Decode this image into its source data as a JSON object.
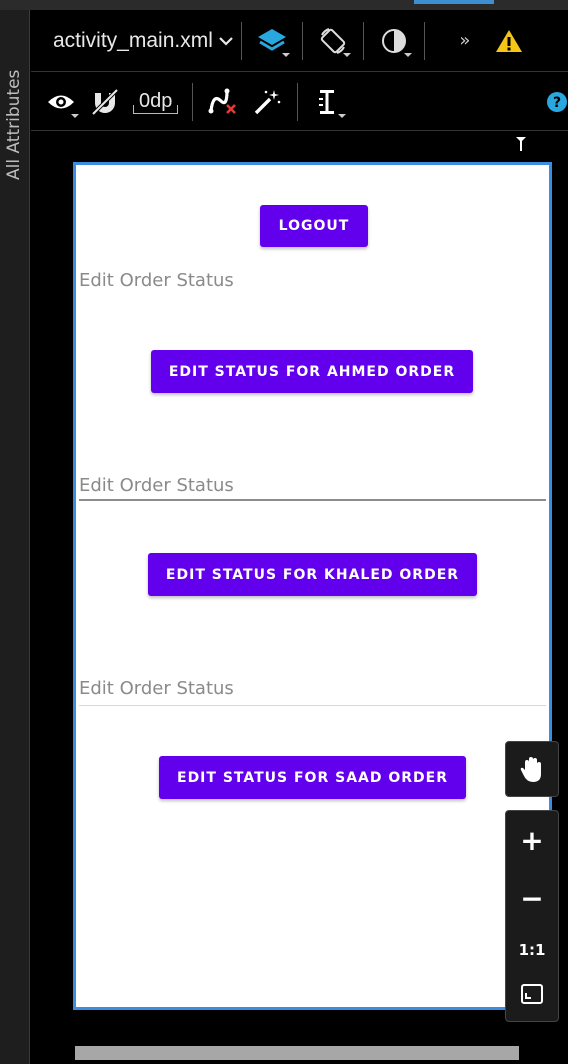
{
  "toolbar": {
    "file_name": "activity_main.xml",
    "margin_value": "0dp"
  },
  "side_panel": {
    "label": "All Attributes"
  },
  "app": {
    "logout_label": "LOGOUT",
    "sections": [
      {
        "hint": "Edit Order Status",
        "button_label": "EDIT STATUS FOR AHMED ORDER"
      },
      {
        "hint": "Edit Order Status",
        "button_label": "EDIT STATUS FOR KHALED ORDER"
      },
      {
        "hint": "Edit Order Status",
        "button_label": "EDIT STATUS FOR SAAD ORDER"
      }
    ]
  },
  "zoom_controls": {
    "zoom_in": "+",
    "zoom_out": "−",
    "one_to_one": "1:1"
  },
  "colors": {
    "button_purple": "#6200ee",
    "device_border": "#3b8de0",
    "warning_yellow": "#f5c518",
    "help_blue": "#29a8e0"
  },
  "icons": {
    "eye": "eye-icon",
    "magnet": "magnet-icon",
    "constraint_clear": "clear-constraints-icon",
    "magic_wand": "magic-wand-icon",
    "guidelines": "guidelines-icon",
    "layers": "layers-icon",
    "orientation": "orientation-icon",
    "theme": "theme-icon",
    "overflow": "overflow-icon",
    "warning": "warning-icon",
    "help": "help-icon",
    "hand": "pan-hand-icon",
    "fit": "fit-screen-icon"
  }
}
